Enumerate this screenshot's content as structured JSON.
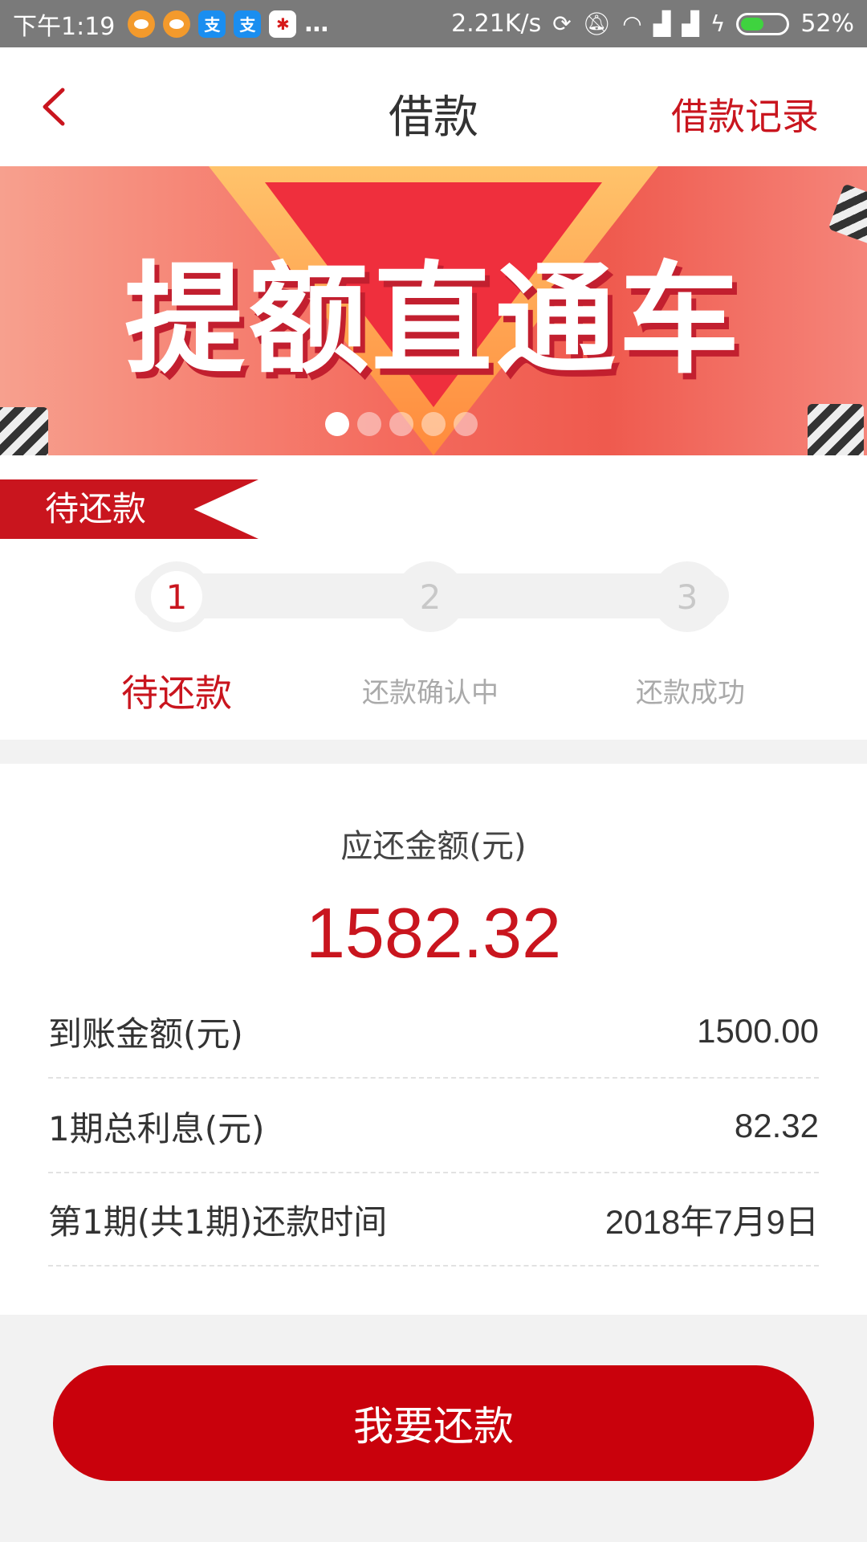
{
  "status_bar": {
    "time": "下午1:19",
    "network_speed": "2.21K/s",
    "battery": "52%",
    "battery_level": 0.52,
    "icons": [
      "message-icon",
      "message-icon",
      "alipay-icon",
      "alipay-icon",
      "app-icon",
      "more-dots",
      "sync-icon",
      "mute-icon",
      "wifi-icon",
      "signal-icon",
      "signal-icon",
      "charging-icon",
      "battery-icon"
    ]
  },
  "header": {
    "title": "借款",
    "record_link": "借款记录"
  },
  "banner": {
    "title": "提额直通车",
    "slide_count": 5,
    "active_slide": 1
  },
  "progress": {
    "tag": "待还款",
    "steps": [
      {
        "number": "1",
        "label": "待还款"
      },
      {
        "number": "2",
        "label": "还款确认中"
      },
      {
        "number": "3",
        "label": "还款成功"
      }
    ],
    "active_step": 1
  },
  "amount": {
    "due_label": "应还金额(元)",
    "due_value": "1582.32",
    "rows": [
      {
        "label": "到账金额(元)",
        "value": "1500.00"
      },
      {
        "label": "1期总利息(元)",
        "value": "82.32"
      },
      {
        "label": "第1期(共1期)还款时间",
        "value": "2018年7月9日"
      }
    ]
  },
  "actions": {
    "repay_label": "我要还款"
  },
  "colors": {
    "accent": "#c9151e",
    "status_bar": "#7a7a7a",
    "background": "#f2f2f2"
  }
}
